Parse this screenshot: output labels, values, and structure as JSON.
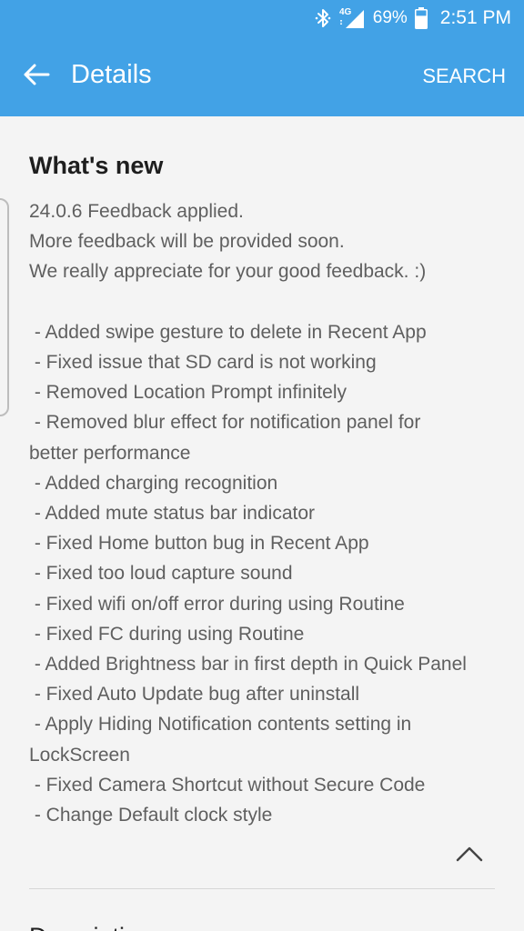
{
  "status_bar": {
    "bluetooth_icon": "bluetooth-icon",
    "network_label": "4G",
    "battery_percent": "69%",
    "battery_level": 0.69,
    "time": "2:51 PM"
  },
  "app_bar": {
    "title": "Details",
    "search_label": "SEARCH",
    "background_color": "#42a2e6"
  },
  "whats_new": {
    "heading": "What's new",
    "lines": [
      "24.0.6 Feedback applied.",
      "More feedback will be provided soon.",
      "We really appreciate for your good feedback. :)",
      "",
      " - Added swipe gesture to delete in Recent App",
      " - Fixed issue that SD card is not working",
      " - Removed Location Prompt infinitely",
      " - Removed blur effect for notification panel for",
      "better performance",
      " - Added charging recognition",
      " - Added mute status bar indicator",
      " - Fixed Home button bug in Recent App",
      " - Fixed too loud capture sound",
      " - Fixed wifi on/off error during using Routine",
      " - Fixed FC during using Routine",
      " - Added Brightness bar in first depth in Quick Panel",
      " - Fixed Auto Update bug after uninstall",
      " - Apply Hiding Notification contents setting in",
      "LockScreen",
      " - Fixed Camera Shortcut without Secure Code",
      " - Change Default clock style"
    ]
  },
  "next_section": {
    "heading": "Description"
  }
}
